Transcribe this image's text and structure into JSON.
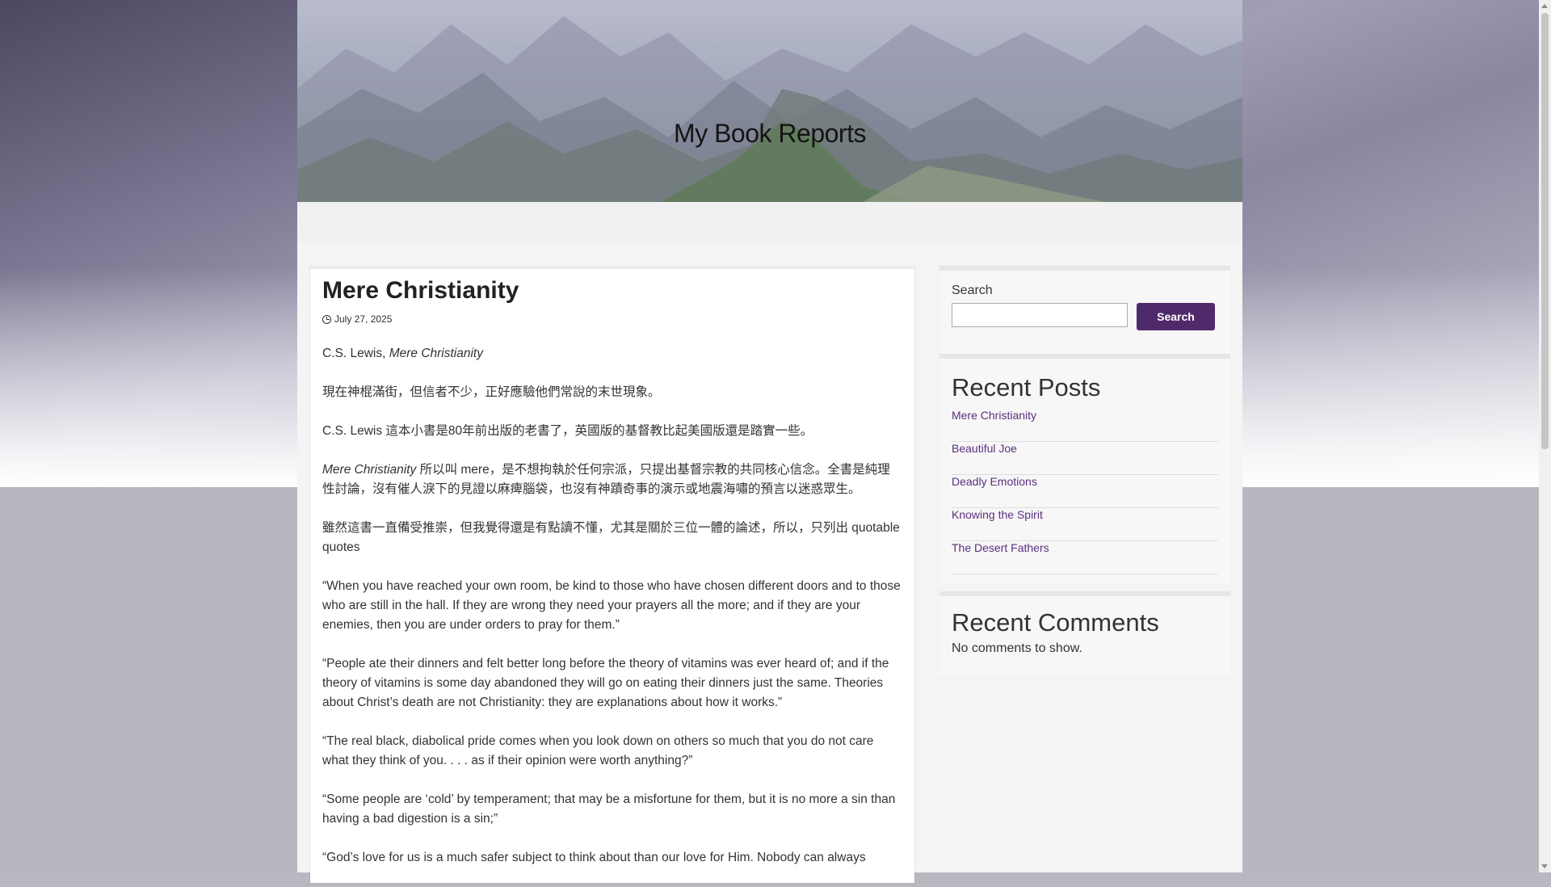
{
  "site": {
    "title": "My Book Reports"
  },
  "post": {
    "title": "Mere Christianity",
    "date": "July 27, 2025",
    "paragraphs": [
      {
        "lead": "C.S. Lewis, ",
        "italic": "Mere Christianity",
        "text": ""
      },
      {
        "lead": "",
        "italic": "",
        "text": "現在神棍滿街，但信者不少，正好應驗他們常說的末世現象。"
      },
      {
        "lead": "",
        "italic": "",
        "text": "C.S. Lewis 這本小書是80年前出版的老書了，英國版的基督教比起美國版還是踏實一些。"
      },
      {
        "lead": "",
        "italic": "Mere Christianity",
        "text": " 所以叫 mere，是不想拘執於任何宗派，只提出基督宗教的共同核心信念。全書是純理性討論，沒有催人淚下的見證以麻痺腦袋，也沒有神蹟奇事的演示或地震海嘯的預言以迷惑眾生。"
      },
      {
        "lead": "",
        "italic": "",
        "text": "雖然這書一直備受推崇，但我覺得還是有點讀不懂，尤其是關於三位一體的論述，所以，只列出 quotable quotes"
      },
      {
        "lead": "",
        "italic": "",
        "text": "“When you have reached your own room, be kind to those who have chosen different doors and to those who are still in the hall. If they are wrong they need your prayers all the more; and if they are your enemies, then you are under orders to pray for them.”"
      },
      {
        "lead": "",
        "italic": "",
        "text": "“People ate their dinners and felt better long before the theory of vitamins was ever heard of; and if the theory of vitamins is some day abandoned they will go on eating their dinners just the same. Theories about Christ’s death are not Christianity: they are explanations about how it works.”"
      },
      {
        "lead": "",
        "italic": "",
        "text": "“The real black, diabolical pride comes when you look down on others so much that you do not care what they think of you. . . . as if their opinion were worth anything?”"
      },
      {
        "lead": "",
        "italic": "",
        "text": "“Some people are ‘cold’ by temperament; that may be a misfortune for them, but it is no more a sin than having a bad digestion is a sin;”"
      },
      {
        "lead": "",
        "italic": "",
        "text": "“God’s love for us is a much safer subject to think about than our love for Him. Nobody can always"
      }
    ]
  },
  "sidebar": {
    "search": {
      "label": "Search",
      "button_label": "Search",
      "value": ""
    },
    "recent_posts": {
      "title": "Recent Posts",
      "items": [
        "Mere Christianity",
        "Beautiful Joe",
        "Deadly Emotions",
        "Knowing the Spirit",
        "The Desert Fathers"
      ]
    },
    "recent_comments": {
      "title": "Recent Comments",
      "empty_text": "No comments to show."
    }
  },
  "colors": {
    "accent": "#4f2a6b",
    "link": "#5b2f7e"
  }
}
